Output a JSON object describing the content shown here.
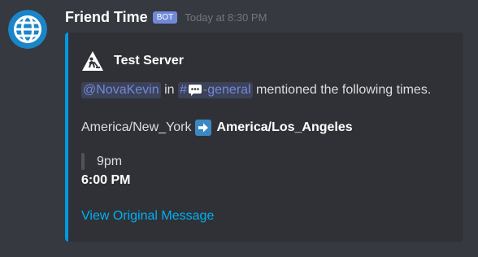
{
  "message": {
    "username": "Friend Time",
    "bot_tag": "BOT",
    "timestamp": "Today at 8:30 PM",
    "avatar_icon": "globe-icon"
  },
  "colors": {
    "background": "#36393f",
    "embed_background": "#2f3136",
    "embed_accent": "#0099e1",
    "mention": "#7289da",
    "link": "#00b0f4"
  },
  "embed": {
    "author_icon": "construction-sign-icon",
    "author_name": "Test Server",
    "mention_user": "@NovaKevin",
    "in_text": "in",
    "channel_hash": "#",
    "channel_icon": "speech-balloon-icon",
    "channel_name": "-general",
    "mention_suffix": "mentioned the following times.",
    "tz_from": "America/New_York",
    "tz_arrow_icon": "right-arrow-icon",
    "tz_to": "America/Los_Angeles",
    "quoted_time": "9pm",
    "converted_time": "6:00 PM",
    "link_text": "View Original Message"
  }
}
